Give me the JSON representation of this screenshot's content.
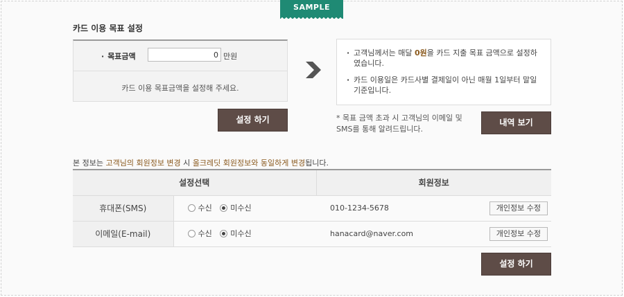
{
  "sample_tag": "SAMPLE",
  "goal_section": {
    "title": "카드 이용 목표 설정",
    "label": "목표금액",
    "input_value": "0",
    "unit": "만원",
    "message": "카드 이용 목표금액을 설정해 주세요.",
    "button": "설정 하기"
  },
  "info": {
    "item1_pre": "고객님께서는 매달 ",
    "item1_highlight": "0원",
    "item1_post": "을 카드 지출 목표 금액으로 설정하였습니다.",
    "item2": "카드 이용일은 카드사별 결제일이 아닌 매월 1일부터 말일 기준입니다."
  },
  "note": "* 목표 금액 초과 시 고객님의 이메일 및 SMS를 통해 알려드립니다.",
  "history_button": "내역 보기",
  "notice": {
    "pre": "본 정보는 ",
    "hl1": "고객님의 회원정보 변경",
    "mid": " 시 ",
    "hl2": "올크레딧 회원정보와 동일하게 변경",
    "post": "됩니다."
  },
  "table": {
    "headers": [
      "설정선택",
      "회원정보"
    ],
    "rows": [
      {
        "type": "휴대폰(SMS)",
        "opt_receive": "수신",
        "opt_decline": "미수신",
        "value": "010-1234-5678",
        "edit": "개인정보 수정"
      },
      {
        "type": "이메일(E-mail)",
        "opt_receive": "수신",
        "opt_decline": "미수신",
        "value": "hanacard@naver.com",
        "edit": "개인정보 수정"
      }
    ]
  },
  "bottom_button": "설정 하기",
  "colors": {
    "accent": "#1f8a74",
    "button": "#5e4c47",
    "highlight": "#8b5a1e"
  }
}
